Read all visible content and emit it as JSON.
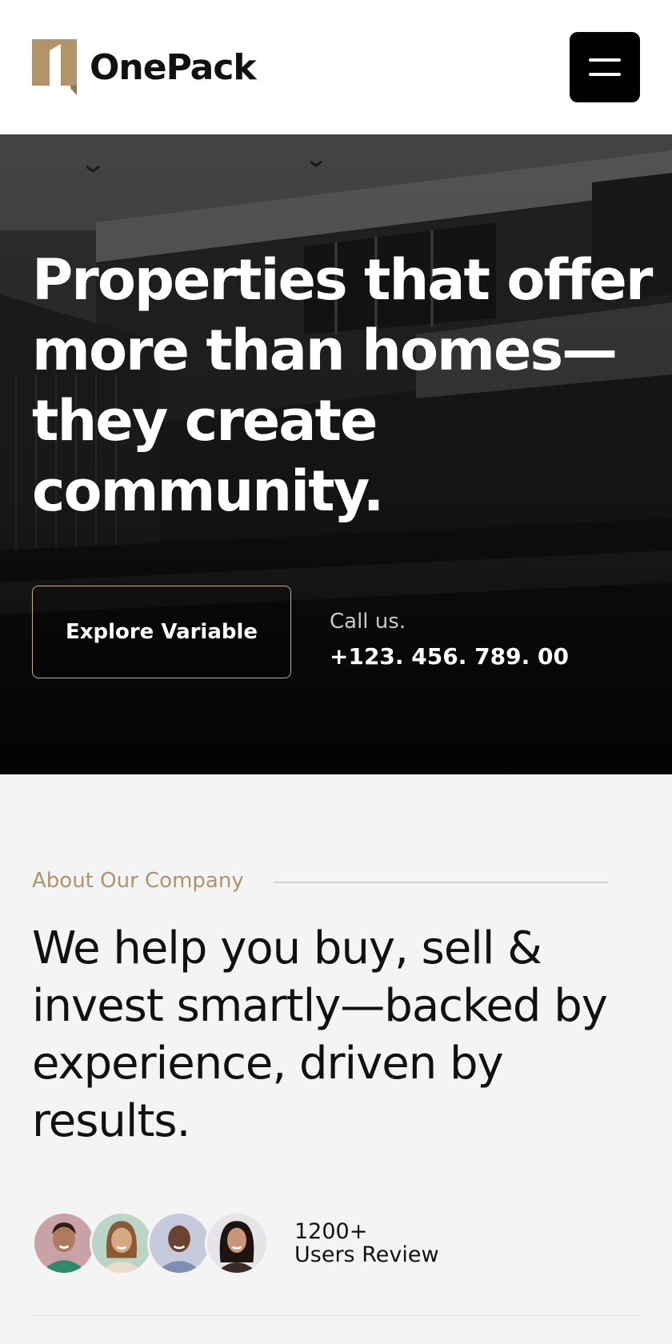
{
  "header": {
    "brand_name": "OnePack",
    "logo_icon": "onepack-logo",
    "menu_icon": "hamburger-menu-icon",
    "colors": {
      "logo_gold": "#b1946a",
      "menu_bg": "#000000"
    }
  },
  "hero": {
    "title": "Properties that offer more than homes—they create community.",
    "explore_button_label": "Explore Variable",
    "call_label": "Call us.",
    "phone_number": "+123. 456. 789. 00",
    "colors": {
      "button_border": "#c9ae85"
    }
  },
  "about": {
    "eyebrow": "About Our Company",
    "title": "We help you buy, sell & invest smartly—backed by experience, driven by results.",
    "review_count": "1200+",
    "review_label": "Users Review",
    "avatars": [
      "avatar-1",
      "avatar-2",
      "avatar-3",
      "avatar-4"
    ],
    "colors": {
      "accent": "#b1946a"
    }
  }
}
